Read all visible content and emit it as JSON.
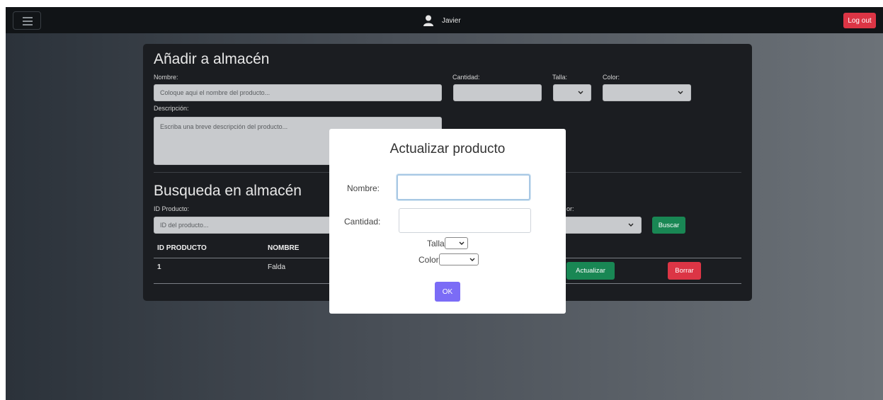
{
  "navbar": {
    "menu_icon": "hamburger-menu-icon",
    "user_icon": "user-icon",
    "user_name": "Javier",
    "logout_label": "Log out"
  },
  "add_section": {
    "title": "Añadir a almacén",
    "nombre_label": "Nombre:",
    "nombre_placeholder": "Coloque aqui el nombre del producto...",
    "cantidad_label": "Cantidad:",
    "talla_label": "Talla:",
    "color_label": "Color:",
    "descripcion_label": "Descripción:",
    "descripcion_placeholder": "Escriba una breve descripción del producto..."
  },
  "search_section": {
    "title": "Busqueda en almacén",
    "id_label": "ID Producto:",
    "id_placeholder": "ID del producto...",
    "color_label_partial": "or:",
    "search_button": "Buscar"
  },
  "table": {
    "headers": [
      "ID PRODUCTO",
      "NOMBRE"
    ],
    "rows": [
      {
        "id": "1",
        "nombre": "Falda",
        "update_label": "Actualizar",
        "delete_label": "Borrar"
      }
    ]
  },
  "modal": {
    "title": "Actualizar producto",
    "nombre_label": "Nombre:",
    "cantidad_label": "Cantidad:",
    "talla_label": "Talla:",
    "color_label": "Color:",
    "ok_label": "OK"
  },
  "colors": {
    "accent_red": "#dc3545",
    "accent_green": "#198754",
    "ok_purple": "#7b6cf6",
    "card_bg": "#1b1d21",
    "navbar_bg": "#111417"
  }
}
